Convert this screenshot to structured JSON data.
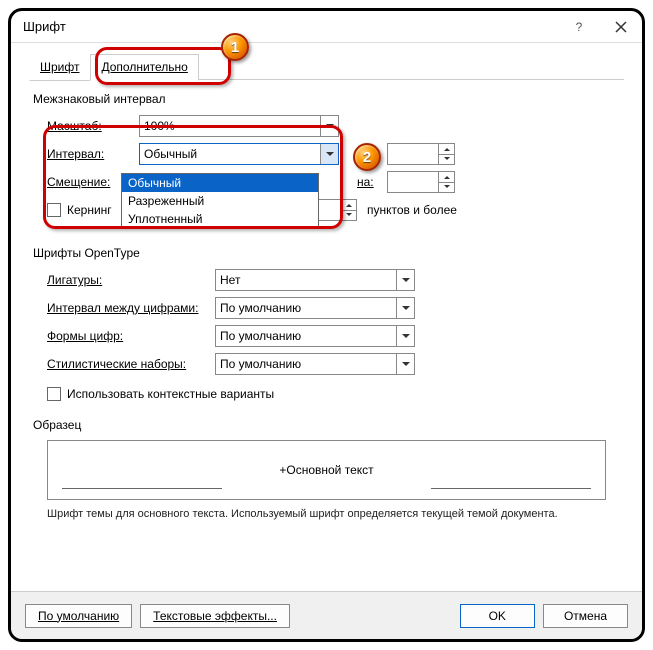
{
  "window": {
    "title": "Шрифт"
  },
  "tabs": {
    "t1": "Шрифт",
    "t2": "Дополнительно"
  },
  "badges": {
    "one": "1",
    "two": "2"
  },
  "spacing": {
    "section": "Межзнаковый интервал",
    "scale_label": "Масштаб:",
    "scale_value": "100%",
    "interval_label": "Интервал:",
    "interval_value": "Обычный",
    "interval_opts": {
      "o1": "Обычный",
      "o2": "Разреженный",
      "o3": "Уплотненный"
    },
    "on1": "на:",
    "offset_label": "Смещение:",
    "on2": "на:",
    "kerning_label": "Кернинг",
    "kerning_suffix": "пунктов и более"
  },
  "opentype": {
    "section": "Шрифты OpenType",
    "ligatures_label": "Лигатуры:",
    "ligatures_value": "Нет",
    "num_spacing_label": "Интервал между цифрами:",
    "num_spacing_value": "По умолчанию",
    "num_forms_label": "Формы цифр:",
    "num_forms_value": "По умолчанию",
    "style_sets_label": "Стилистические наборы:",
    "style_sets_value": "По умолчанию",
    "contextual_label": "Использовать контекстные варианты"
  },
  "preview": {
    "section": "Образец",
    "text": "+Основной текст",
    "desc": "Шрифт темы для основного текста. Используемый шрифт определяется текущей темой документа."
  },
  "footer": {
    "default": "По умолчанию",
    "effects": "Текстовые эффекты...",
    "ok": "OK",
    "cancel": "Отмена"
  }
}
